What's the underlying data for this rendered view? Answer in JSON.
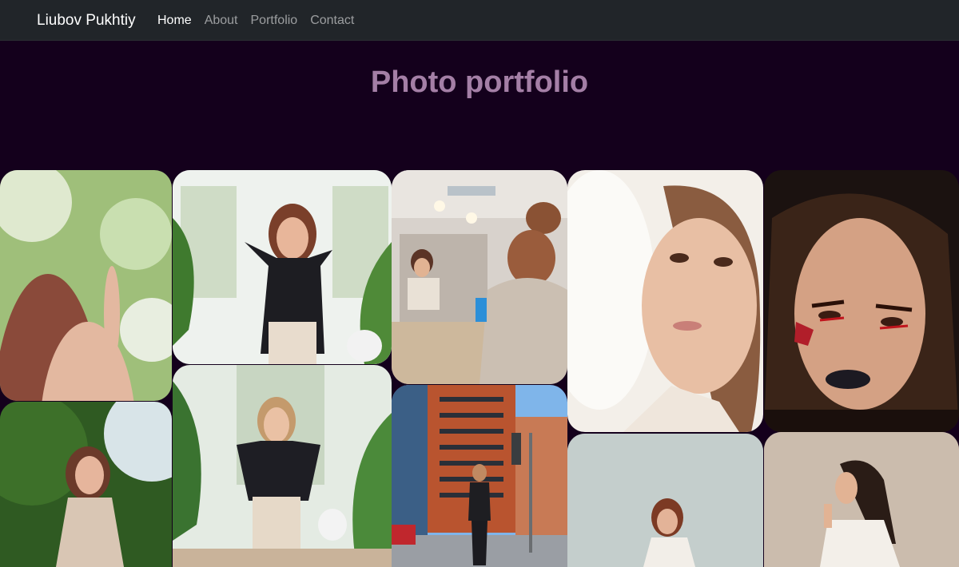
{
  "nav": {
    "brand": "Liubov Pukhtiy",
    "links": [
      {
        "label": "Home",
        "active": true
      },
      {
        "label": "About",
        "active": false
      },
      {
        "label": "Portfolio",
        "active": false
      },
      {
        "label": "Contact",
        "active": false
      }
    ]
  },
  "hero": {
    "title": "Photo portfolio"
  },
  "colors": {
    "navbar_bg": "#212529",
    "page_bg": "#14001c",
    "title": "#a47fa6"
  }
}
